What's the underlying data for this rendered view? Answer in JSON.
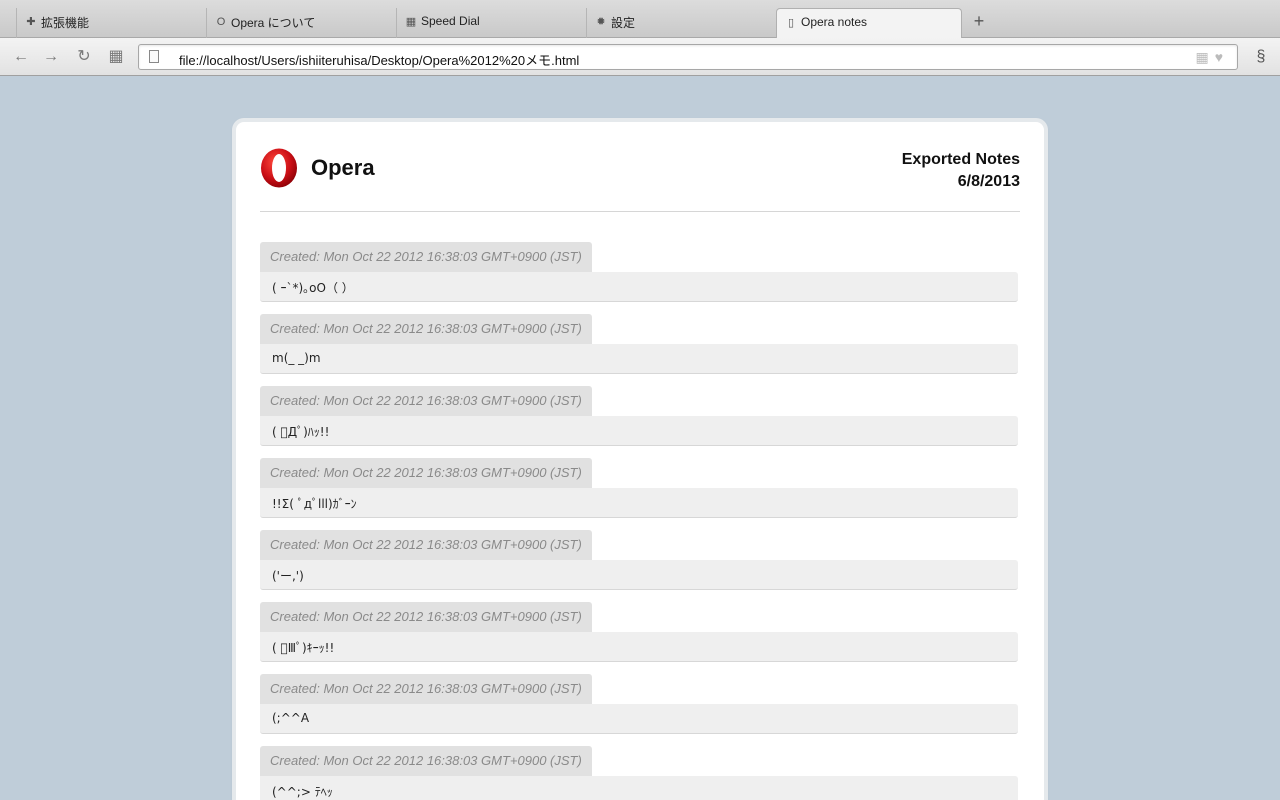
{
  "tabs": [
    {
      "label": "拡張機能",
      "icon": "puzzle-icon"
    },
    {
      "label": "Opera について",
      "icon": "opera-icon"
    },
    {
      "label": "Speed Dial",
      "icon": "grid-icon"
    },
    {
      "label": "設定",
      "icon": "gear-icon"
    },
    {
      "label": "Opera notes",
      "icon": "page-icon",
      "active": true
    }
  ],
  "address": {
    "url": "file://localhost/Users/ishiiteruhisa/Desktop/Opera%2012%20メモ.html"
  },
  "page": {
    "brand": "Opera",
    "exported_title": "Exported Notes",
    "exported_date": "6/8/2013"
  },
  "notes": [
    {
      "created": "Created: Mon Oct 22 2012 16:38:03 GMT+0900 (JST)",
      "text": "( ｰ`*)｡oO（ ）"
    },
    {
      "created": "Created: Mon Oct 22 2012 16:38:03 GMT+0900 (JST)",
      "text": "m(_ _)m"
    },
    {
      "created": "Created: Mon Oct 22 2012 16:38:03 GMT+0900 (JST)",
      "text": "( ﾟДﾟ)ﾊｯ!!"
    },
    {
      "created": "Created: Mon Oct 22 2012 16:38:03 GMT+0900 (JST)",
      "text": "!!Σ( ﾟдﾟlll)ｶﾞｰﾝ"
    },
    {
      "created": "Created: Mon Oct 22 2012 16:38:03 GMT+0900 (JST)",
      "text": "('ー,')"
    },
    {
      "created": "Created: Mon Oct 22 2012 16:38:03 GMT+0900 (JST)",
      "text": "( ﾟⅢﾟ)ｷｰｯ!!"
    },
    {
      "created": "Created: Mon Oct 22 2012 16:38:03 GMT+0900 (JST)",
      "text": "(;^^A"
    },
    {
      "created": "Created: Mon Oct 22 2012 16:38:03 GMT+0900 (JST)",
      "text": "(^^;> ﾃﾍｯ"
    }
  ],
  "colors": {
    "background": "#bfcdd9",
    "logo_red": "#cc0f16"
  }
}
